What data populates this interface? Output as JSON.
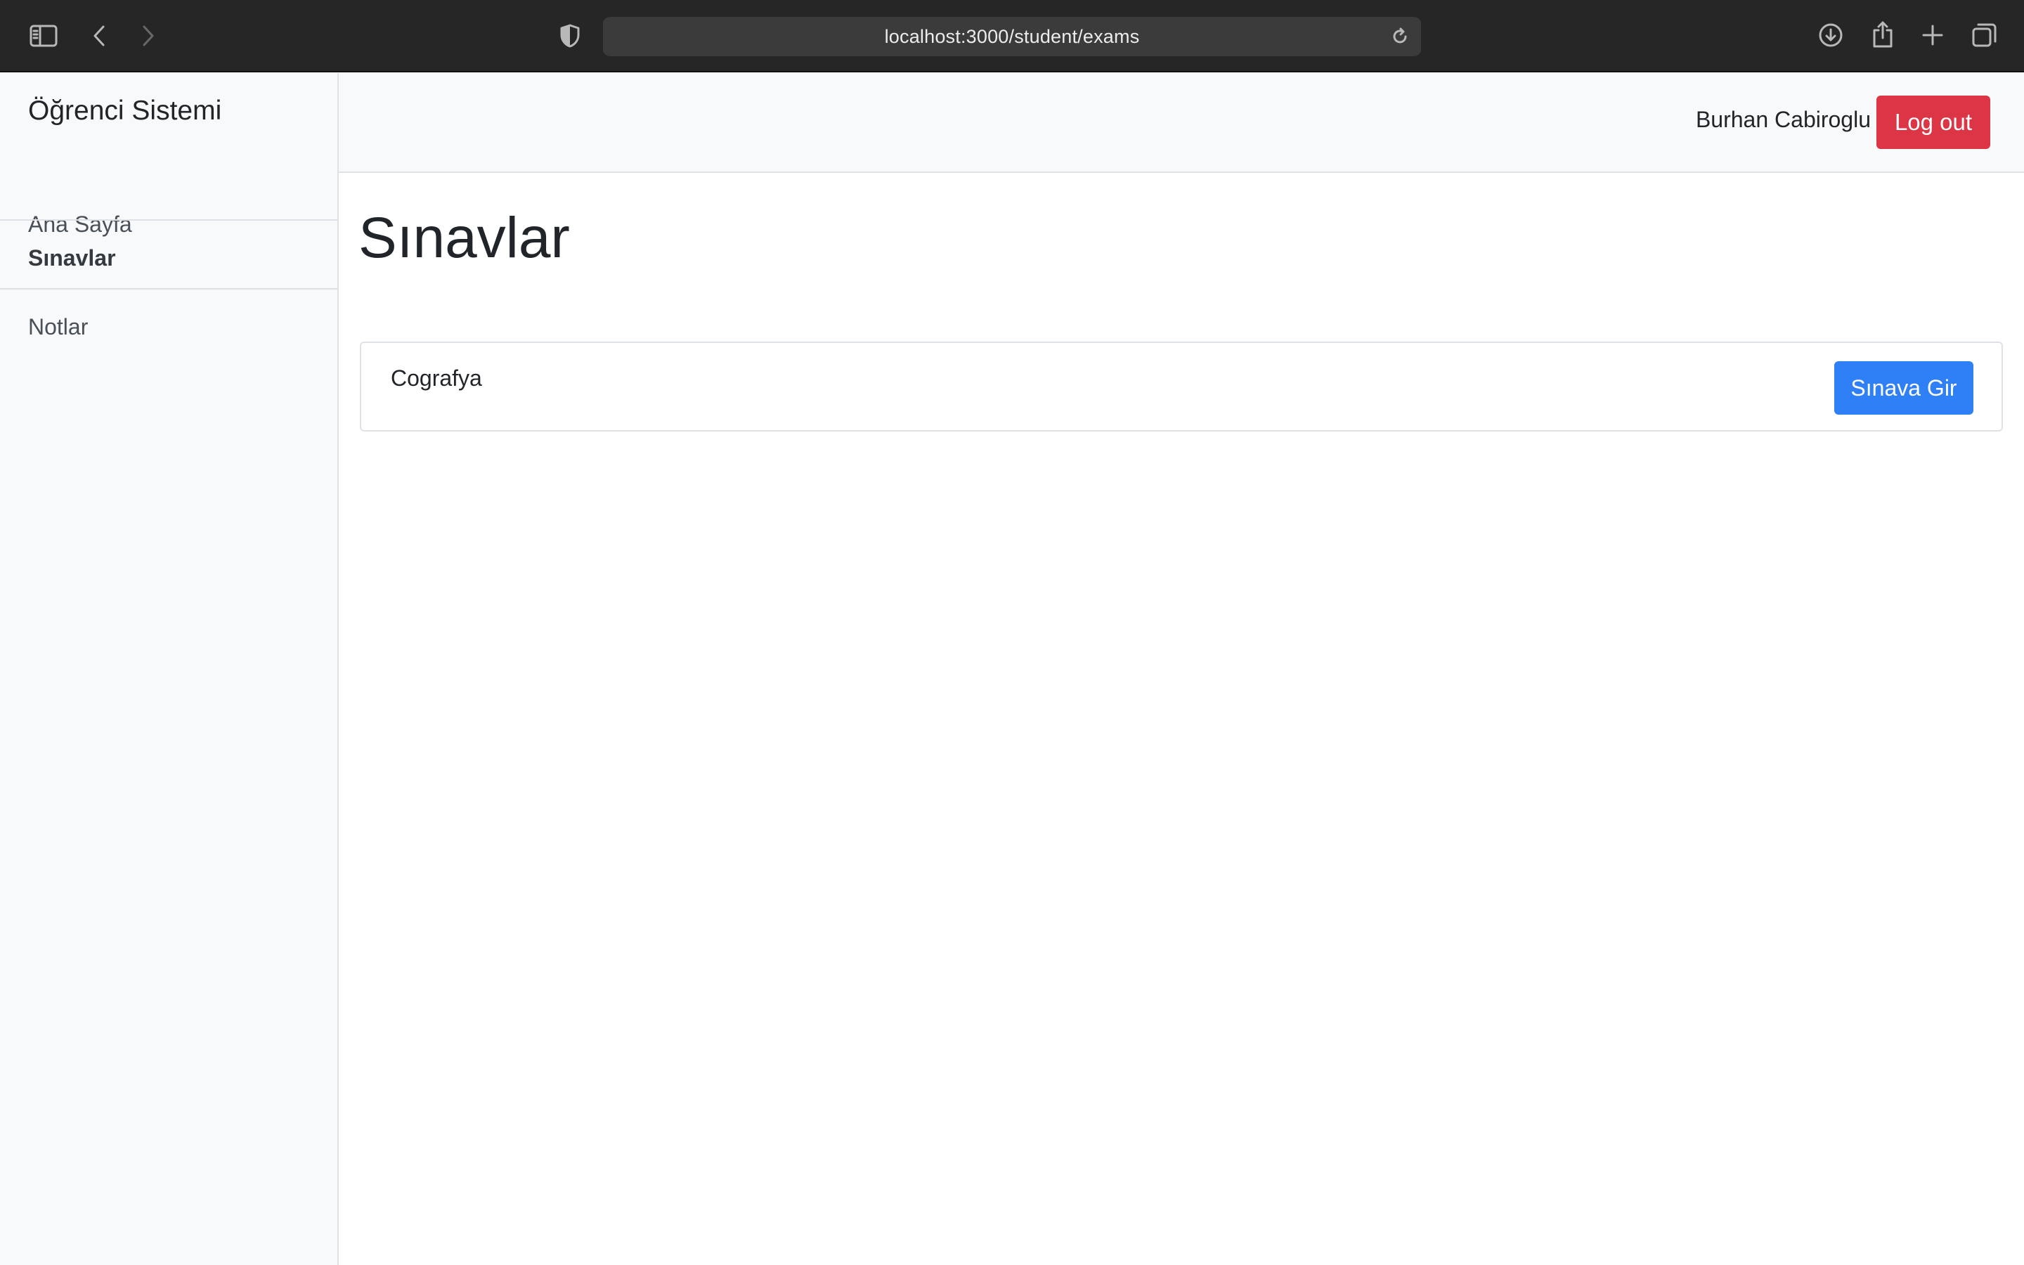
{
  "browser": {
    "url": "localhost:3000/student/exams",
    "icons": [
      "sidebar-toggle-icon",
      "back-arrow-icon",
      "forward-arrow-icon",
      "shield-icon",
      "reload-icon",
      "download-icon",
      "share-icon",
      "new-tab-plus-icon",
      "tab-overview-icon"
    ]
  },
  "sidebar": {
    "brand": "Öğrenci Sistemi",
    "items": [
      {
        "label": "Ana Sayfa",
        "active": false
      },
      {
        "label": "Sınavlar",
        "active": true
      },
      {
        "label": "Notlar",
        "active": false
      }
    ]
  },
  "header": {
    "user_name": "Burhan Cabiroglu",
    "logout_label": "Log out",
    "logout_color": "#dc3545"
  },
  "main": {
    "title": "Sınavlar",
    "exams": [
      {
        "name": "Cografya",
        "action_label": "Sınava Gir"
      }
    ],
    "accent_color": "#2f7ff6"
  }
}
